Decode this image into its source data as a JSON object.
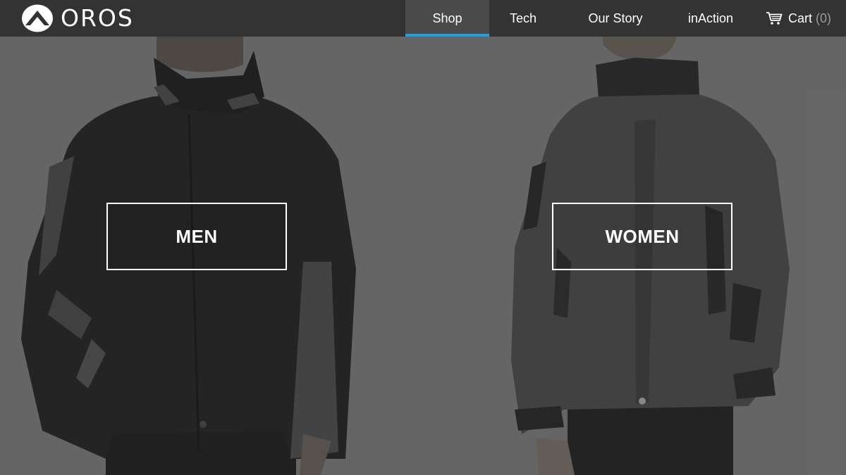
{
  "brand": {
    "name": "OROS",
    "logo_icon": "mountain-peak-icon"
  },
  "nav": {
    "items": [
      {
        "label": "Shop",
        "active": true
      },
      {
        "label": "Tech",
        "active": false
      },
      {
        "label": "Our Story",
        "active": false
      },
      {
        "label": "inAction",
        "active": false
      }
    ],
    "cart": {
      "icon": "shopping-cart-icon",
      "label": "Cart",
      "count": "(0)"
    }
  },
  "hero": {
    "men": {
      "cta_label": "MEN"
    },
    "women": {
      "cta_label": "WOMEN"
    }
  },
  "colors": {
    "nav_background": "#333333",
    "active_tab_background": "#4a4a4a",
    "active_indicator": "#1ea0e0",
    "hero_background": "#6e6e6e",
    "text": "#ffffff",
    "cart_count": "#9a9a9a"
  }
}
